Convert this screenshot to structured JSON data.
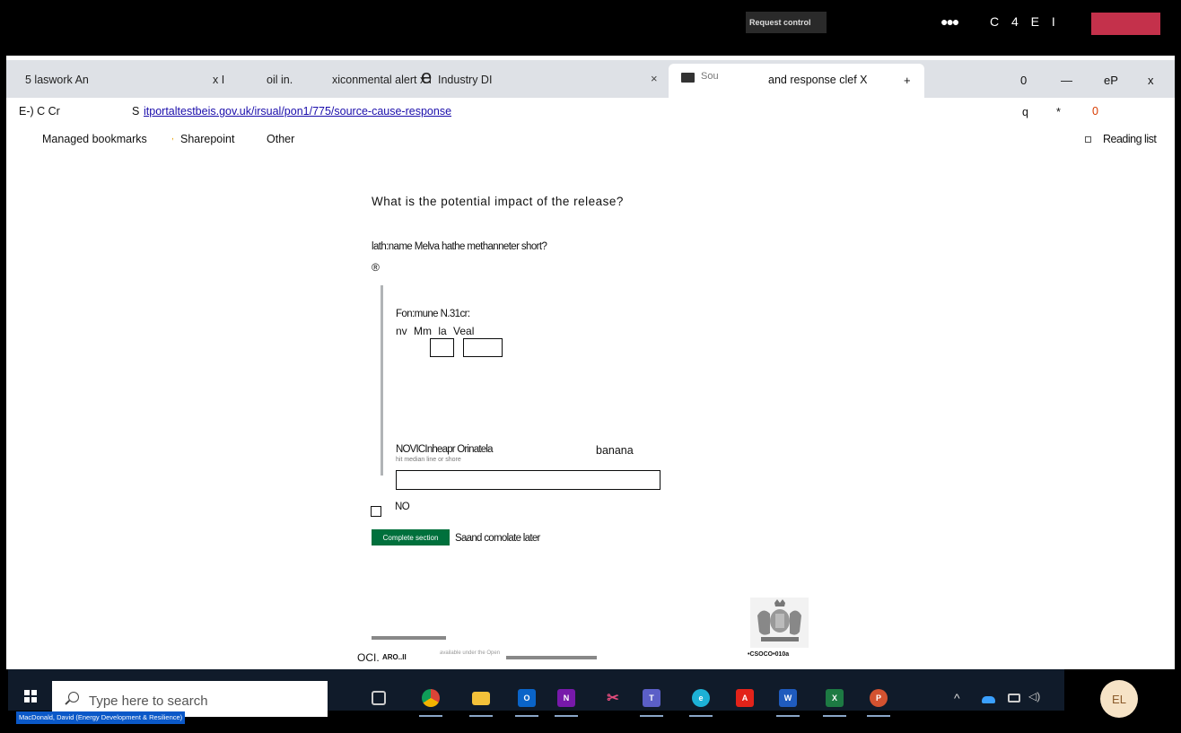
{
  "meeting_bar": {
    "request_control": "Request control",
    "controls": "C 4 E I",
    "accent_leave": "#c4314b"
  },
  "tabs": [
    {
      "title": "5 laswork An",
      "close": "x I"
    },
    {
      "title": "oil  in."
    },
    {
      "title": "xiconmental alert x I",
      "glyph": "e",
      "suffix": "Industry DI"
    },
    {
      "title": "Sou",
      "close": "×"
    },
    {
      "title": "and response clef X",
      "active": true
    }
  ],
  "tabstrip": {
    "new_tab": "+",
    "btn_a": "0",
    "minimize": "—",
    "btn_b": "eP",
    "close": "x"
  },
  "addressbar": {
    "nav": "E-) C Cr",
    "prefix": "S",
    "url": "itportaltestbeis.gov.uk/irsual/pon1/775/source-cause-response",
    "zoom": "q",
    "star": "*",
    "alert": "0"
  },
  "bookmarks": {
    "managed": "Managed bookmarks",
    "sep": ",",
    "sharepoint": "Sharepoint",
    "other": "Other",
    "reading_list": "Reading list"
  },
  "form": {
    "question": "What is the potential impact of the release?",
    "hint": "lath:name Melva hathe methanneter short?",
    "info_icon": "®",
    "date_legend": "Fon:mune N.31cr:",
    "date_labels": "nv  Mm la Veal",
    "distance_label": "NOVICInheapr Orinatela",
    "distance_hint": "hit median line or shore",
    "banana": "banana",
    "no_label": "NO",
    "complete_button": "Complete section",
    "save_later": "Saand comolate later",
    "accent_green": "#00703c"
  },
  "footer": {
    "ogl": "OCI.",
    "ogl_abbr": "ARO..II",
    "ogl_note": "available under the Open",
    "crown": "•CSOCO•010a"
  },
  "taskbar": {
    "search_placeholder": "Type here to search",
    "presenter": "MacDonald, David (Energy Development & Resilience)",
    "apps": [
      "task-view",
      "chrome",
      "file-explorer",
      "outlook",
      "onenote",
      "snipping-tool",
      "teams",
      "edge",
      "acrobat",
      "word",
      "excel",
      "powerpoint"
    ],
    "avatar": "EL"
  }
}
